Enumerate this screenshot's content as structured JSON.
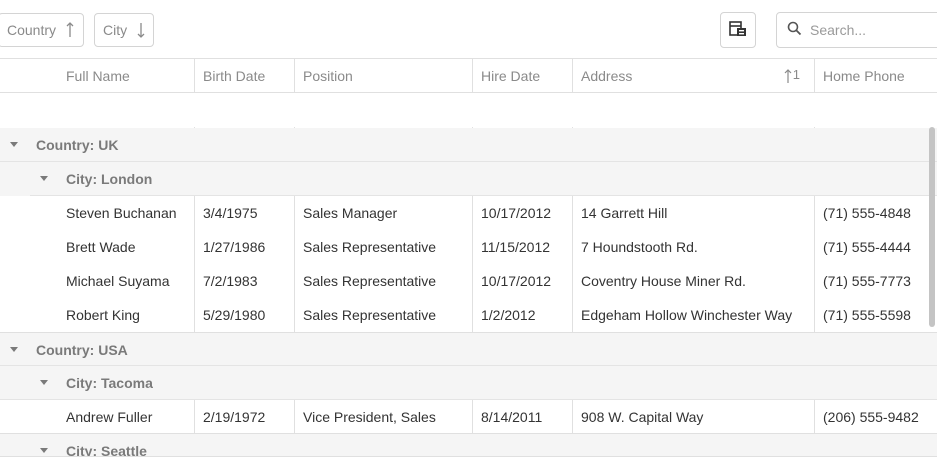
{
  "group_panel": {
    "chips": [
      {
        "label": "Country",
        "sort": "ascending"
      },
      {
        "label": "City",
        "sort": "descending"
      }
    ]
  },
  "toolbar": {
    "column_chooser_icon": "column-chooser-icon",
    "search_placeholder": "Search..."
  },
  "columns": {
    "full_name": "Full Name",
    "birth_date": "Birth Date",
    "position": "Position",
    "hire_date": "Hire Date",
    "address": "Address",
    "address_sort_index": "1",
    "home_phone": "Home Phone"
  },
  "groups": {
    "uk": "Country: UK",
    "london": "City: London",
    "usa": "Country: USA",
    "tacoma": "City: Tacoma",
    "seattle": "City: Seattle"
  },
  "rows": [
    {
      "full_name": "Steven Buchanan",
      "birth_date": "3/4/1975",
      "position": "Sales Manager",
      "hire_date": "10/17/2012",
      "address": "14 Garrett Hill",
      "home_phone": "(71) 555-4848"
    },
    {
      "full_name": "Brett Wade",
      "birth_date": "1/27/1986",
      "position": "Sales Representative",
      "hire_date": "11/15/2012",
      "address": "7 Houndstooth Rd.",
      "home_phone": "(71) 555-4444"
    },
    {
      "full_name": "Michael Suyama",
      "birth_date": "7/2/1983",
      "position": "Sales Representative",
      "hire_date": "10/17/2012",
      "address": "Coventry House Miner Rd.",
      "home_phone": "(71) 555-7773"
    },
    {
      "full_name": "Robert King",
      "birth_date": "5/29/1980",
      "position": "Sales Representative",
      "hire_date": "1/2/2012",
      "address": "Edgeham Hollow Winchester Way",
      "home_phone": "(71) 555-5598"
    },
    {
      "full_name": "Andrew Fuller",
      "birth_date": "2/19/1972",
      "position": "Vice President, Sales",
      "hire_date": "8/14/2011",
      "address": "908 W. Capital Way",
      "home_phone": "(206) 555-9482"
    }
  ],
  "colors": {
    "group_bg": "#f5f5f5",
    "border": "#e0e0e0",
    "header_text": "#8a8a8a"
  }
}
